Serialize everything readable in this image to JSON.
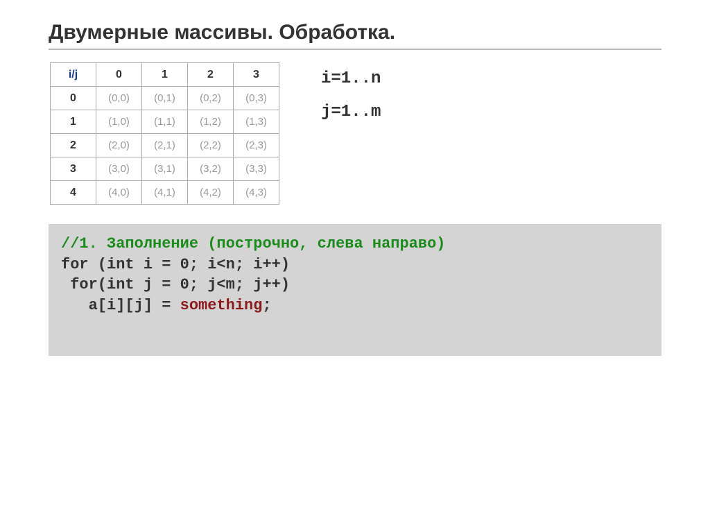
{
  "title": "Двумерные массивы. Обработка.",
  "table": {
    "ij_label": "i/j",
    "col_headers": [
      "0",
      "1",
      "2",
      "3"
    ],
    "row_headers": [
      "0",
      "1",
      "2",
      "3",
      "4"
    ],
    "cells": [
      [
        "(0,0)",
        "(0,1)",
        "(0,2)",
        "(0,3)"
      ],
      [
        "(1,0)",
        "(1,1)",
        "(1,2)",
        "(1,3)"
      ],
      [
        "(2,0)",
        "(2,1)",
        "(2,2)",
        "(2,3)"
      ],
      [
        "(3,0)",
        "(3,1)",
        "(3,2)",
        "(3,3)"
      ],
      [
        "(4,0)",
        "(4,1)",
        "(4,2)",
        "(4,3)"
      ]
    ]
  },
  "ranges": {
    "line1": "i=1..n",
    "line2": "j=1..m"
  },
  "code": {
    "comment": "//1. Заполнение (построчно, слева направо)",
    "line2_a": "for (int i = 0; i<n; i++)",
    "line3_a": " for(int j = 0; j<m; j++)",
    "line4_a": "   a[i][j] = ",
    "line4_kw": "something",
    "line4_b": ";"
  }
}
